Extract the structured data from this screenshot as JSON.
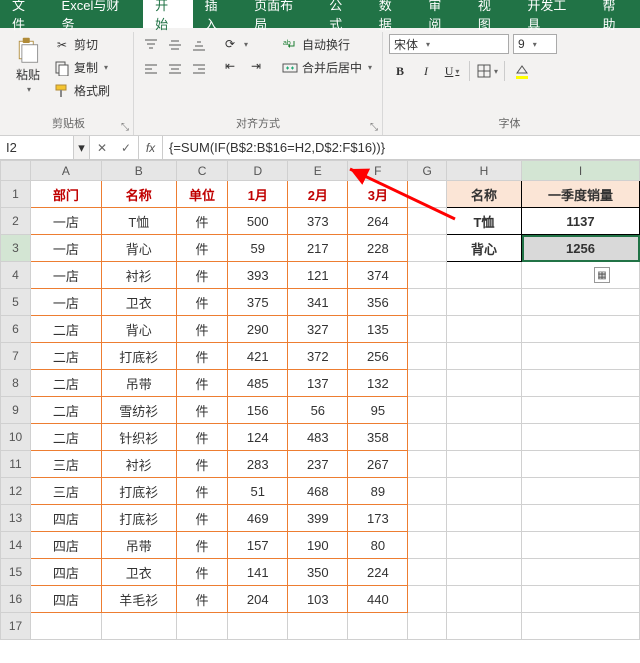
{
  "tabs": {
    "file": "文件",
    "excel_fin": "Excel与财务",
    "home": "开始",
    "insert": "插入",
    "layout": "页面布局",
    "formulas": "公式",
    "data": "数据",
    "review": "审阅",
    "view": "视图",
    "dev": "开发工具",
    "help": "帮助"
  },
  "ribbon": {
    "clipboard": {
      "paste": "粘贴",
      "cut": "剪切",
      "copy": "复制",
      "painter": "格式刷",
      "group_label": "剪贴板"
    },
    "align": {
      "wrap": "自动换行",
      "merge": "合并后居中",
      "group_label": "对齐方式"
    },
    "font": {
      "name": "宋体",
      "size": "9",
      "group_label": "字体"
    }
  },
  "formula_bar": {
    "cell_ref": "I2",
    "formula": "{=SUM(IF(B$2:B$16=H2,D$2:F$16))}"
  },
  "columns": [
    "A",
    "B",
    "C",
    "D",
    "E",
    "F",
    "G",
    "H",
    "I"
  ],
  "headers": {
    "A": "部门",
    "B": "名称",
    "C": "单位",
    "D": "1月",
    "E": "2月",
    "F": "3月"
  },
  "lookup_headers": {
    "H": "名称",
    "I": "一季度销量"
  },
  "rows": [
    {
      "A": "一店",
      "B": "T恤",
      "C": "件",
      "D": 500,
      "E": 373,
      "F": 264
    },
    {
      "A": "一店",
      "B": "背心",
      "C": "件",
      "D": 59,
      "E": 217,
      "F": 228
    },
    {
      "A": "一店",
      "B": "衬衫",
      "C": "件",
      "D": 393,
      "E": 121,
      "F": 374
    },
    {
      "A": "一店",
      "B": "卫衣",
      "C": "件",
      "D": 375,
      "E": 341,
      "F": 356
    },
    {
      "A": "二店",
      "B": "背心",
      "C": "件",
      "D": 290,
      "E": 327,
      "F": 135
    },
    {
      "A": "二店",
      "B": "打底衫",
      "C": "件",
      "D": 421,
      "E": 372,
      "F": 256
    },
    {
      "A": "二店",
      "B": "吊带",
      "C": "件",
      "D": 485,
      "E": 137,
      "F": 132
    },
    {
      "A": "二店",
      "B": "雪纺衫",
      "C": "件",
      "D": 156,
      "E": 56,
      "F": 95
    },
    {
      "A": "二店",
      "B": "针织衫",
      "C": "件",
      "D": 124,
      "E": 483,
      "F": 358
    },
    {
      "A": "三店",
      "B": "衬衫",
      "C": "件",
      "D": 283,
      "E": 237,
      "F": 267
    },
    {
      "A": "三店",
      "B": "打底衫",
      "C": "件",
      "D": 51,
      "E": 468,
      "F": 89
    },
    {
      "A": "四店",
      "B": "打底衫",
      "C": "件",
      "D": 469,
      "E": 399,
      "F": 173
    },
    {
      "A": "四店",
      "B": "吊带",
      "C": "件",
      "D": 157,
      "E": 190,
      "F": 80
    },
    {
      "A": "四店",
      "B": "卫衣",
      "C": "件",
      "D": 141,
      "E": 350,
      "F": 224
    },
    {
      "A": "四店",
      "B": "羊毛衫",
      "C": "件",
      "D": 204,
      "E": 103,
      "F": 440
    }
  ],
  "lookup": [
    {
      "H": "T恤",
      "I": 1137
    },
    {
      "H": "背心",
      "I": 1256
    }
  ],
  "selected_cell": "I3",
  "col_widths": {
    "corner": 28,
    "A": 66,
    "B": 70,
    "C": 48,
    "D": 56,
    "E": 56,
    "F": 56,
    "G": 36,
    "H": 70,
    "I": 110
  }
}
